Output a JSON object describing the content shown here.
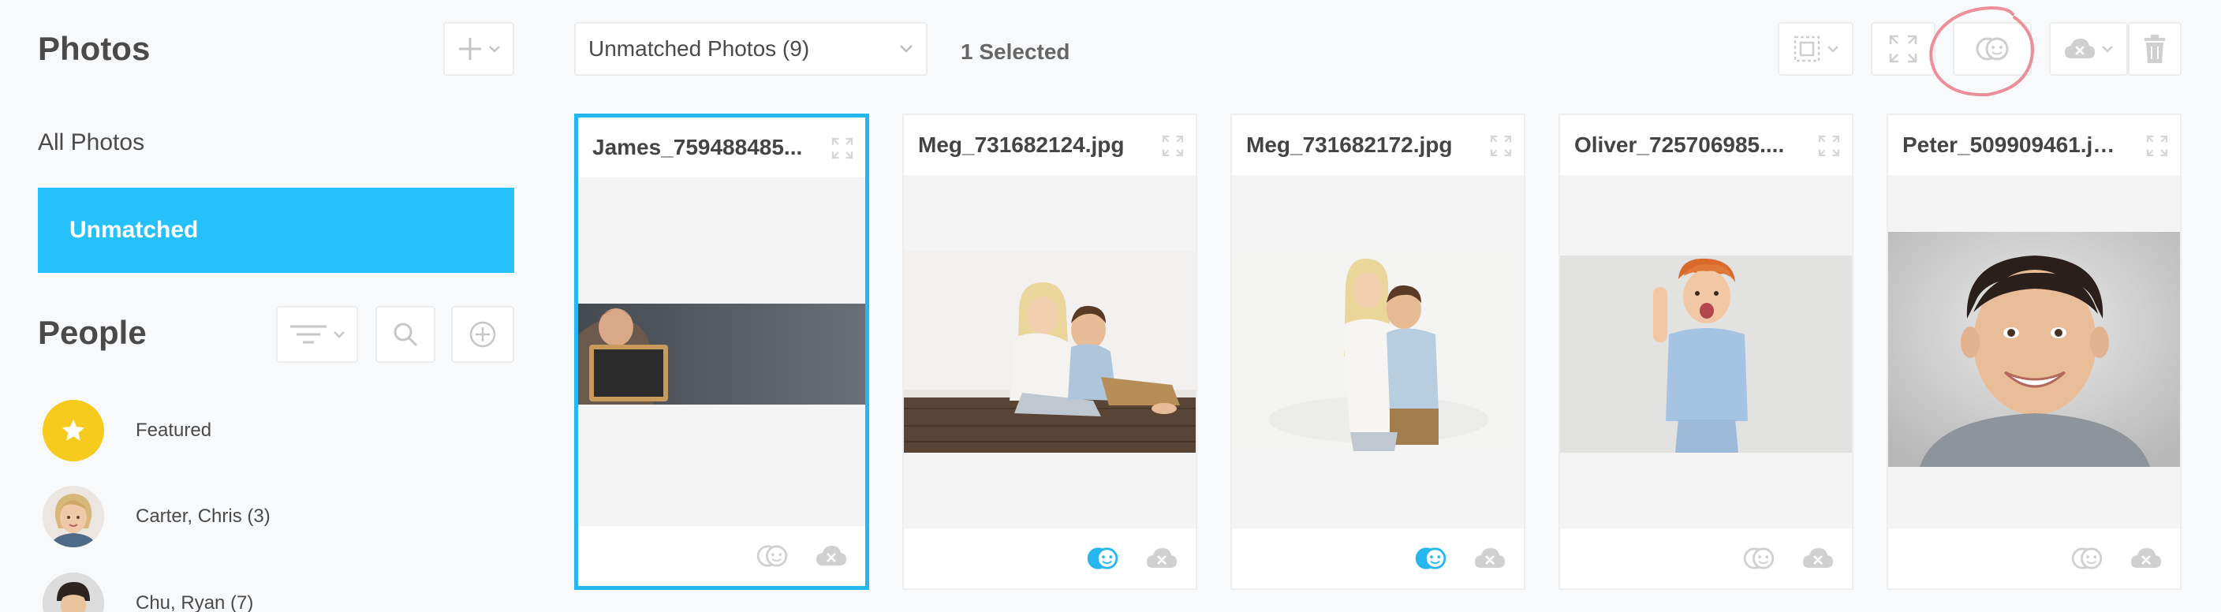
{
  "sidebar": {
    "title": "Photos",
    "nav": {
      "all": "All Photos",
      "unmatched": "Unmatched"
    },
    "people_title": "People",
    "people": [
      {
        "name": "Featured"
      },
      {
        "name": "Carter, Chris (3)"
      },
      {
        "name": "Chu, Ryan (7)"
      }
    ]
  },
  "toolbar": {
    "album_select": "Unmatched Photos (9)",
    "selected_count": "1 Selected"
  },
  "photos": [
    {
      "name": "James_759488485...",
      "selected": true
    },
    {
      "name": "Meg_731682124.jpg",
      "matched": true
    },
    {
      "name": "Meg_731682172.jpg",
      "matched": true
    },
    {
      "name": "Oliver_725706985...."
    },
    {
      "name": "Peter_509909461.jpg"
    }
  ],
  "colors": {
    "accent": "#26c0fa",
    "selected_border": "#26b7ef",
    "featured": "#f6cb1e",
    "annotation": "#ec8f98",
    "icon_gray": "#cfcfcf"
  }
}
